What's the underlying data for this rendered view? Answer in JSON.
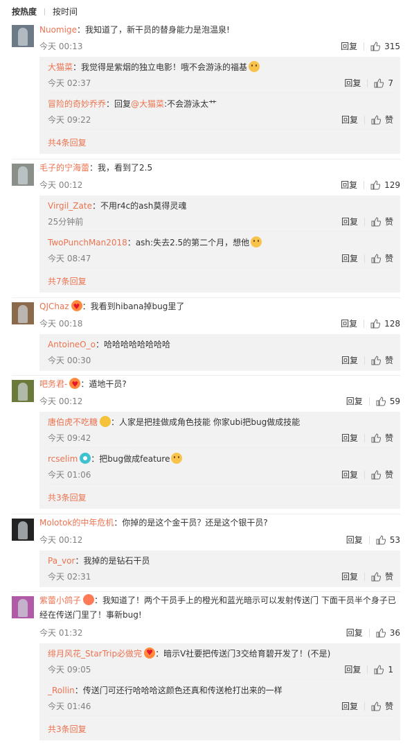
{
  "sort": {
    "hot": "按热度",
    "time": "按时间"
  },
  "comments": [
    {
      "user": "Nuomige",
      "sep": "：",
      "text": "我知道了，新干员的替身能力是泡温泉!",
      "time": "今天 00:13",
      "reply": "回复",
      "likes": "315",
      "replies": [
        {
          "user": "大猫菜",
          "sep": "：",
          "text": "我觉得是紫烟的独立电影！哦不会游泳的福基",
          "time": "今天 02:37",
          "reply": "回复",
          "likes": "7"
        },
        {
          "user": "冒险的奇妙乔乔",
          "sep": "：",
          "text_pre": "回复",
          "mention": "@大猫菜",
          "text": ":不会游泳太艹",
          "time": "今天 09:22",
          "reply": "回复",
          "likes": "赞"
        }
      ],
      "more": "共4条回复"
    },
    {
      "user": "毛子的宁海蕾",
      "sep": "：",
      "text": "我，看到了2.5",
      "time": "今天 00:12",
      "reply": "回复",
      "likes": "129",
      "replies": [
        {
          "user": "Virgil_Zate",
          "sep": "：",
          "text": "不用r4c的ash莫得灵魂",
          "time": "25分钟前",
          "reply": "回复",
          "likes": "赞"
        },
        {
          "user": "TwoPunchMan2018",
          "sep": "：",
          "text": "ash:失去2.5的第二个月，想他",
          "time": "今天 08:47",
          "reply": "回复",
          "likes": "赞"
        }
      ],
      "more": "共7条回复"
    },
    {
      "user": "QJChaz",
      "sep": "：",
      "text": "我看到hibana掉bug里了",
      "time": "今天 00:18",
      "reply": "回复",
      "likes": "128",
      "replies": [
        {
          "user": "AntoineO_o",
          "sep": "：",
          "text": "哈哈哈哈哈哈哈哈",
          "time": "今天 00:30",
          "reply": "回复",
          "likes": "赞"
        }
      ]
    },
    {
      "user": "吧务君-",
      "sep": "：",
      "text": "遁地干员?",
      "time": "今天 00:12",
      "reply": "回复",
      "likes": "59",
      "replies": [
        {
          "user": "唐伯虎不吃糖",
          "sep": "：",
          "text": "人家是把挂做成角色技能 你家ubi把bug做成技能",
          "time": "今天 09:42",
          "reply": "回复",
          "likes": "赞"
        },
        {
          "user": "rcselim",
          "sep": "：",
          "text": "把bug做成feature",
          "time": "今天 01:06",
          "reply": "回复",
          "likes": "赞"
        }
      ],
      "more": "共3条回复"
    },
    {
      "user": "Molotok的中年危机",
      "sep": "：",
      "text": "你掉的是这个金干员？还是这个银干员?",
      "time": "今天 00:12",
      "reply": "回复",
      "likes": "53",
      "replies": [
        {
          "user": "Pa_vor",
          "sep": "：",
          "text": "我掉的是钻石干员",
          "time": "今天 02:31",
          "reply": "回复",
          "likes": "赞"
        }
      ]
    },
    {
      "user": "紫蕾小鸽子",
      "sep": "：",
      "text": "我知道了！两个干员手上的橙光和蓝光暗示可以发射传送门 下面干员半个身子已经在传送门里了！事新bug!",
      "time": "今天 01:32",
      "reply": "回复",
      "likes": "36",
      "replies": [
        {
          "user": "绯月风花_StarTrip必做完",
          "sep": "：",
          "text": "暗示V社要把传送门3交给育碧开发了！(不是)",
          "time": "今天 09:05",
          "reply": "回复",
          "likes": "1"
        },
        {
          "user": "_Rollin",
          "sep": "：",
          "text": "传送门可还行哈哈哈这颜色还真和传送枪打出来的一样",
          "time": "今天 01:46",
          "reply": "回复",
          "likes": "赞"
        }
      ],
      "more": "共3条回复"
    }
  ]
}
